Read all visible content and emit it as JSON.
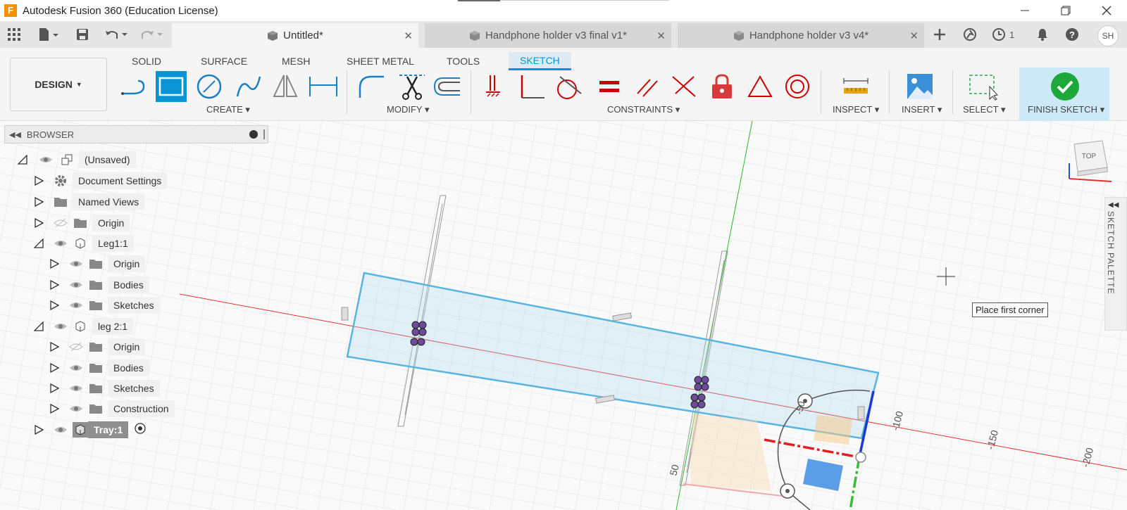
{
  "window": {
    "title": "Autodesk Fusion 360 (Education License)",
    "logo_letter": "F"
  },
  "tabs": [
    {
      "label": "Untitled*",
      "active": true
    },
    {
      "label": "Handphone holder v3 final v1*",
      "active": false
    },
    {
      "label": "Handphone holder v3 v4*",
      "active": false
    }
  ],
  "header_right": {
    "job_count": "1",
    "avatar": "SH"
  },
  "workspace": {
    "label": "DESIGN"
  },
  "ribbon_tabs": [
    "SOLID",
    "SURFACE",
    "MESH",
    "SHEET METAL",
    "TOOLS",
    "SKETCH"
  ],
  "ribbon_groups": {
    "create": "CREATE",
    "modify": "MODIFY",
    "constraints": "CONSTRAINTS",
    "inspect": "INSPECT",
    "insert": "INSERT",
    "select": "SELECT",
    "finish": "FINISH SKETCH"
  },
  "browser": {
    "title": "BROWSER",
    "items": [
      {
        "label": "(Unsaved)"
      },
      {
        "label": "Document Settings"
      },
      {
        "label": "Named Views"
      },
      {
        "label": "Origin"
      },
      {
        "label": "Leg1:1"
      },
      {
        "label": "Origin"
      },
      {
        "label": "Bodies"
      },
      {
        "label": "Sketches"
      },
      {
        "label": "leg 2:1"
      },
      {
        "label": "Origin"
      },
      {
        "label": "Bodies"
      },
      {
        "label": "Sketches"
      },
      {
        "label": "Construction"
      },
      {
        "label": "Tray:1"
      }
    ]
  },
  "viewcube": {
    "label": "TOP"
  },
  "axis_labels": [
    "-50",
    "-100",
    "-150",
    "-200",
    "50"
  ],
  "tooltip": "Place first corner",
  "sketch_palette": "SKETCH PALETTE",
  "colors": {
    "accent": "#0696d7",
    "finish_green": "#1ca83a",
    "x_axis": "#e03030",
    "y_axis": "#2fb82f"
  }
}
